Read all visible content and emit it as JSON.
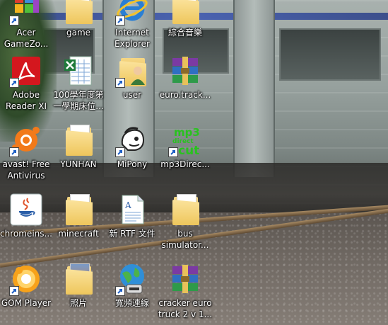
{
  "desktop": {
    "icons": [
      {
        "id": "acer-gamezone",
        "label": "Acer\nGameZo...",
        "icon": "acer-gamezone-icon",
        "shortcut": true
      },
      {
        "id": "game",
        "label": "game",
        "icon": "folder-icon",
        "shortcut": false
      },
      {
        "id": "internet-explorer",
        "label": "Internet\nExplorer",
        "icon": "internet-explorer-icon",
        "shortcut": true
      },
      {
        "id": "folder-zonghe",
        "label": "綜合音樂",
        "icon": "folder-icon",
        "shortcut": false
      },
      {
        "id": "adobe-reader",
        "label": "Adobe\nReader XI",
        "icon": "adobe-reader-icon",
        "shortcut": true
      },
      {
        "id": "excel-file",
        "label": "100學年度第\n一學期床位...",
        "icon": "excel-file-icon",
        "shortcut": false
      },
      {
        "id": "user",
        "label": "user",
        "icon": "user-folder-icon",
        "shortcut": true
      },
      {
        "id": "euro-track",
        "label": "euro.track...",
        "icon": "winrar-archive-icon",
        "shortcut": false
      },
      {
        "id": "avast",
        "label": "avast! Free\nAntivirus",
        "icon": "avast-icon",
        "shortcut": true
      },
      {
        "id": "yunhan",
        "label": "YUNHAN",
        "icon": "folder-icon",
        "shortcut": false
      },
      {
        "id": "mipony",
        "label": "MiPony",
        "icon": "mipony-icon",
        "shortcut": true
      },
      {
        "id": "mp3directcut",
        "label": "mp3Direc...",
        "icon": "mp3directcut-icon",
        "shortcut": true
      },
      {
        "id": "chromeinstall",
        "label": "chromeins...",
        "icon": "java-icon",
        "shortcut": false
      },
      {
        "id": "minecraft",
        "label": "minecraft",
        "icon": "folder-icon",
        "shortcut": false
      },
      {
        "id": "rtf-file",
        "label": "新 RTF 文件",
        "icon": "rtf-document-icon",
        "shortcut": false
      },
      {
        "id": "bus-simulator",
        "label": "bus\nsimulator...",
        "icon": "folder-icon",
        "shortcut": false
      },
      {
        "id": "gom-player",
        "label": "GOM Player",
        "icon": "gom-player-icon",
        "shortcut": true
      },
      {
        "id": "photos",
        "label": "照片",
        "icon": "photo-folder-icon",
        "shortcut": false
      },
      {
        "id": "broadband",
        "label": "寬頻連線",
        "icon": "broadband-connection-icon",
        "shortcut": true
      },
      {
        "id": "cracker-euro",
        "label": "cracker euro\ntruck 2 v 1...",
        "icon": "winrar-archive-icon",
        "shortcut": false
      }
    ]
  },
  "colors": {
    "label_text": "#ffffff",
    "folder": "#eec65c",
    "adobe_red": "#d4171e",
    "avast_orange": "#f27a1a",
    "ie_blue": "#2a7fd4",
    "mp3_green": "#29c21f"
  }
}
